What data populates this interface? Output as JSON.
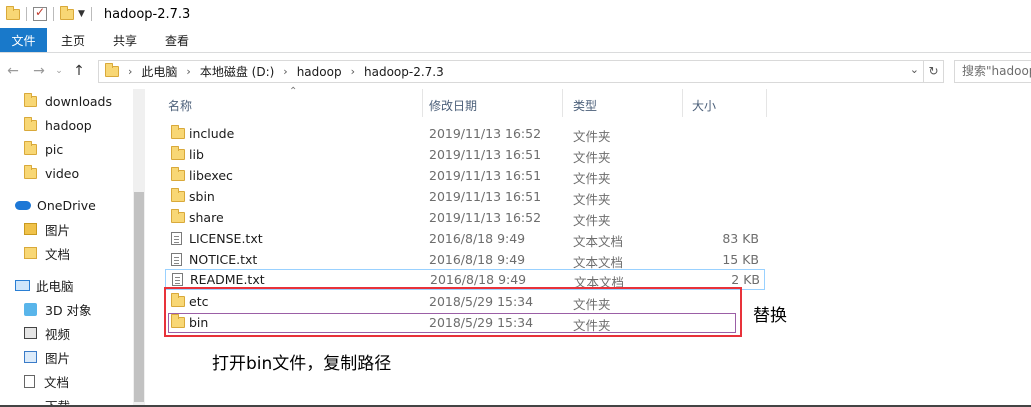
{
  "window": {
    "title": "hadoop-2.7.3"
  },
  "ribbon": {
    "tabs": [
      "文件",
      "主页",
      "共享",
      "查看"
    ]
  },
  "address": {
    "crumbs": [
      "此电脑",
      "本地磁盘 (D:)",
      "hadoop",
      "hadoop-2.7.3"
    ],
    "search_placeholder": "搜索\"hadoop"
  },
  "sidebar": {
    "items": [
      {
        "label": "downloads",
        "icon": "folder-icon"
      },
      {
        "label": "hadoop",
        "icon": "folder-icon"
      },
      {
        "label": "pic",
        "icon": "folder-icon"
      },
      {
        "label": "video",
        "icon": "folder-icon"
      },
      {
        "label": "OneDrive",
        "icon": "cloud-icon"
      },
      {
        "label": "图片",
        "icon": "folder-icon"
      },
      {
        "label": "文档",
        "icon": "folder-icon"
      },
      {
        "label": "此电脑",
        "icon": "pc-icon"
      },
      {
        "label": "3D 对象",
        "icon": "3d-objects-icon"
      },
      {
        "label": "视频",
        "icon": "video-icon"
      },
      {
        "label": "图片",
        "icon": "pictures-icon"
      },
      {
        "label": "文档",
        "icon": "documents-icon"
      },
      {
        "label": "下载",
        "icon": "downloads-icon"
      }
    ]
  },
  "columns": {
    "name": "名称",
    "modified": "修改日期",
    "type": "类型",
    "size": "大小"
  },
  "files": [
    {
      "name": "include",
      "date": "2019/11/13 16:52",
      "type": "文件夹",
      "size": "",
      "icon": "folder-icon"
    },
    {
      "name": "lib",
      "date": "2019/11/13 16:51",
      "type": "文件夹",
      "size": "",
      "icon": "folder-icon"
    },
    {
      "name": "libexec",
      "date": "2019/11/13 16:51",
      "type": "文件夹",
      "size": "",
      "icon": "folder-icon"
    },
    {
      "name": "sbin",
      "date": "2019/11/13 16:51",
      "type": "文件夹",
      "size": "",
      "icon": "folder-icon"
    },
    {
      "name": "share",
      "date": "2019/11/13 16:52",
      "type": "文件夹",
      "size": "",
      "icon": "folder-icon"
    },
    {
      "name": "LICENSE.txt",
      "date": "2016/8/18 9:49",
      "type": "文本文档",
      "size": "83 KB",
      "icon": "text-file-icon"
    },
    {
      "name": "NOTICE.txt",
      "date": "2016/8/18 9:49",
      "type": "文本文档",
      "size": "15 KB",
      "icon": "text-file-icon"
    },
    {
      "name": "README.txt",
      "date": "2016/8/18 9:49",
      "type": "文本文档",
      "size": "2 KB",
      "icon": "text-file-icon"
    },
    {
      "name": "etc",
      "date": "2018/5/29 15:34",
      "type": "文件夹",
      "size": "",
      "icon": "folder-icon"
    },
    {
      "name": "bin",
      "date": "2018/5/29 15:34",
      "type": "文件夹",
      "size": "",
      "icon": "folder-icon"
    }
  ],
  "annotations": {
    "replace": "替换",
    "open_bin": "打开bin文件，复制路径"
  },
  "colors": {
    "accent": "#1979ca",
    "highlight_red": "#e8323a",
    "highlight_purple": "#9b5fa6"
  }
}
